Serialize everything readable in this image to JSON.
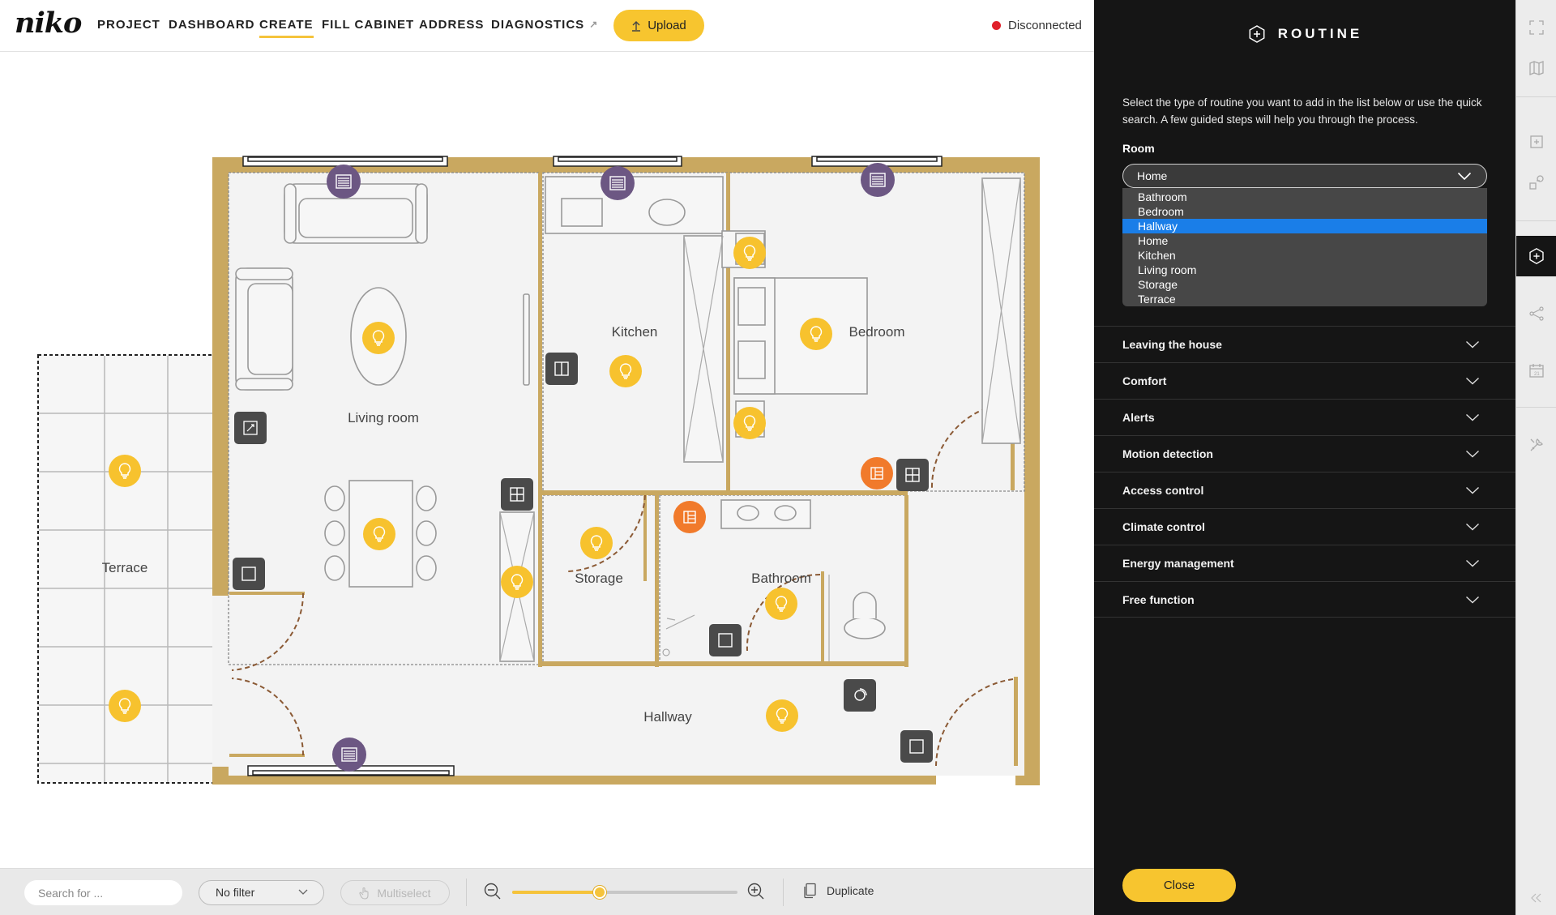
{
  "header": {
    "logo": "niko",
    "nav": [
      {
        "label": "PROJECT"
      },
      {
        "label": "DASHBOARD"
      },
      {
        "label": "CREATE"
      },
      {
        "label": "FILL CABINET"
      },
      {
        "label": "ADDRESS"
      },
      {
        "label": "DIAGNOSTICS"
      }
    ],
    "active_nav": "CREATE",
    "upload_label": "Upload",
    "status": "Disconnected",
    "status_color": "#e0202a"
  },
  "floorplan": {
    "rooms": [
      {
        "name": "Living room"
      },
      {
        "name": "Kitchen"
      },
      {
        "name": "Bedroom"
      },
      {
        "name": "Terrace"
      },
      {
        "name": "Storage"
      },
      {
        "name": "Bathroom"
      },
      {
        "name": "Hallway"
      }
    ],
    "wall_color": "#c9a860",
    "light_color": "#f7c22e",
    "blind_color": "#6c5783",
    "alert_color": "#f17a2b"
  },
  "toolbar": {
    "search_placeholder": "Search for ...",
    "filter": "No filter",
    "multiselect": "Multiselect",
    "zoom_level": 0.39,
    "duplicate": "Duplicate"
  },
  "panel": {
    "title": "ROUTINE",
    "description": "Select the type of routine you want to add in the list below or use the quick search. A few guided steps will help you through the process.",
    "room_label": "Room",
    "room_selected": "Home",
    "room_options": [
      "Bathroom",
      "Bedroom",
      "Hallway",
      "Home",
      "Kitchen",
      "Living room",
      "Storage",
      "Terrace"
    ],
    "room_highlighted": "Hallway",
    "categories": [
      {
        "label": "Leaving the house"
      },
      {
        "label": "Comfort"
      },
      {
        "label": "Alerts"
      },
      {
        "label": "Motion detection"
      },
      {
        "label": "Access control"
      },
      {
        "label": "Climate control"
      },
      {
        "label": "Energy management"
      },
      {
        "label": "Free function"
      }
    ],
    "close_label": "Close",
    "accent": "#f7c52f"
  }
}
